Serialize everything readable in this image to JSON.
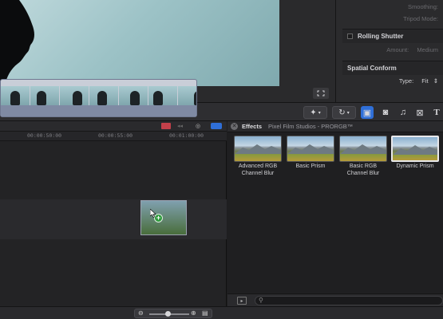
{
  "inspector": {
    "smoothing_label": "Smoothing:",
    "tripod_label": "Tripod Mode:",
    "rolling_shutter": "Rolling Shutter",
    "amount_label": "Amount:",
    "amount_value": "Medium",
    "spatial_conform": "Spatial Conform",
    "type_label": "Type:",
    "type_value": "Fit"
  },
  "timeline": {
    "ruler": [
      "00:00:50:00",
      "00:00:55:00",
      "00:01:00:00"
    ]
  },
  "effects": {
    "title": "Effects",
    "path": "Pixel Film Studios - PRORGB™",
    "items": [
      {
        "label": "Advanced RGB Channel Blur"
      },
      {
        "label": "Basic Prism"
      },
      {
        "label": "Basic RGB Channel Blur"
      },
      {
        "label": "Dynamic Prism"
      }
    ],
    "search_placeholder": ""
  },
  "colors": {
    "accent": "#2f6fd8",
    "clip_footer": "#7f8aa3",
    "add_badge": "#2e9a3c"
  },
  "icons": [
    "magic-wand-icon",
    "retime-icon",
    "video-effects-icon",
    "camera-icon",
    "music-icon",
    "transitions-icon",
    "text-icon",
    "zoom-out-icon",
    "zoom-in-icon",
    "clip-appearance-icon",
    "fullscreen-icon",
    "search-icon"
  ]
}
